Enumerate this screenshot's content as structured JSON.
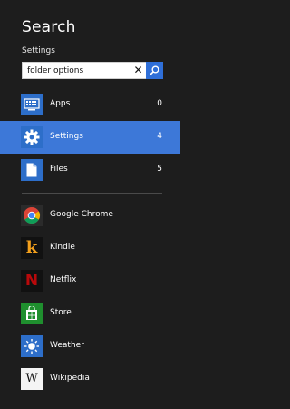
{
  "charm": {
    "title": "Search",
    "scope": "Settings"
  },
  "search": {
    "value": "folder options",
    "placeholder": "",
    "clear_glyph": "✕"
  },
  "scopes": [
    {
      "label": "Apps",
      "count": "0",
      "icon": "apps-icon",
      "selected": false
    },
    {
      "label": "Settings",
      "count": "4",
      "icon": "gear-icon",
      "selected": true
    },
    {
      "label": "Files",
      "count": "5",
      "icon": "file-icon",
      "selected": false
    }
  ],
  "apps": [
    {
      "label": "Google Chrome",
      "icon": "chrome-icon"
    },
    {
      "label": "Kindle",
      "icon": "kindle-icon",
      "glyph": "k"
    },
    {
      "label": "Netflix",
      "icon": "netflix-icon",
      "glyph": "N"
    },
    {
      "label": "Store",
      "icon": "store-icon"
    },
    {
      "label": "Weather",
      "icon": "weather-icon"
    },
    {
      "label": "Wikipedia",
      "icon": "wikipedia-icon",
      "glyph": "W"
    }
  ],
  "colors": {
    "background": "#1d1d1d",
    "accent": "#3d78d8",
    "tile_blue": "#2d6ec9",
    "search_button": "#2f6fd8",
    "store_green": "#1f8f2e",
    "netflix_red": "#b9090b",
    "kindle_orange": "#f4a01c"
  }
}
